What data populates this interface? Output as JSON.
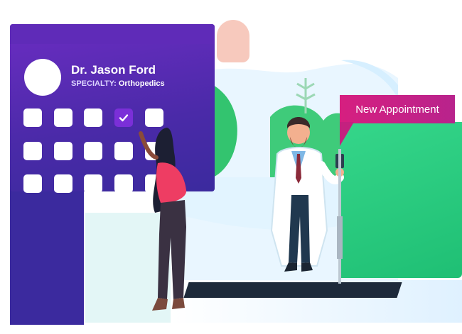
{
  "doctor": {
    "name": "Dr. Jason Ford",
    "specialty_label": "SPECIALTY:",
    "specialty_value": "Orthopedics"
  },
  "appointment": {
    "label": "New Appointment"
  },
  "calendar": {
    "rows": 3,
    "cols": 5,
    "checked_day": {
      "row": 1,
      "col": 4
    }
  },
  "colors": {
    "card_purple": "#4a2aa8",
    "tag_magenta": "#d61f80",
    "panel_green": "#2ecc82"
  },
  "icons": {
    "check": "check-icon"
  }
}
